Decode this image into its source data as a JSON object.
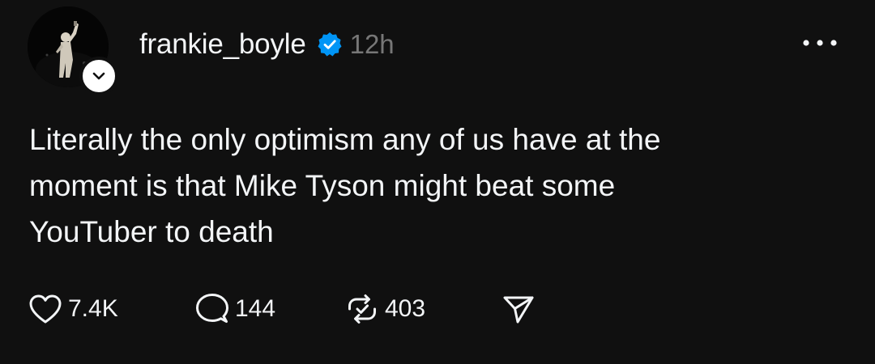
{
  "post": {
    "author": {
      "username": "frankie_boyle",
      "verified": true,
      "avatar_icon": "performer-photo",
      "follow_icon": "chevron-down-icon"
    },
    "timestamp": "12h",
    "text": "Literally the only optimism any of us have at the\nmoment is that Mike Tyson might beat some\nYouTuber to death",
    "actions": {
      "likes": "7.4K",
      "replies": "144",
      "reposts": "403"
    }
  },
  "colors": {
    "background": "#101010",
    "text": "#f3f5f7",
    "muted": "#777777",
    "verified_blue": "#0095f6"
  }
}
